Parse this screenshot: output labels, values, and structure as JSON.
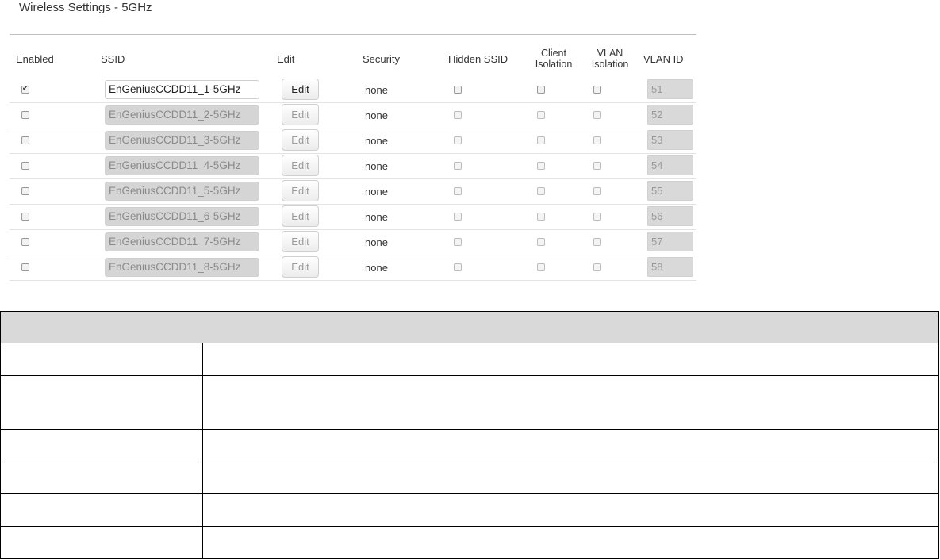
{
  "panel": {
    "title": "Wireless Settings - 5GHz",
    "headers": {
      "enabled": "Enabled",
      "ssid": "SSID",
      "edit": "Edit",
      "security": "Security",
      "hidden_ssid": "Hidden SSID",
      "client_isolation_1": "Client",
      "client_isolation_2": "Isolation",
      "vlan_isolation_1": "VLAN",
      "vlan_isolation_2": "Isolation",
      "vlan_id": "VLAN ID"
    },
    "rows": [
      {
        "enabled": true,
        "ssid": "EnGeniusCCDD11_1-5GHz",
        "edit": "Edit",
        "security": "none",
        "vlan_id": "51"
      },
      {
        "enabled": false,
        "ssid": "EnGeniusCCDD11_2-5GHz",
        "edit": "Edit",
        "security": "none",
        "vlan_id": "52"
      },
      {
        "enabled": false,
        "ssid": "EnGeniusCCDD11_3-5GHz",
        "edit": "Edit",
        "security": "none",
        "vlan_id": "53"
      },
      {
        "enabled": false,
        "ssid": "EnGeniusCCDD11_4-5GHz",
        "edit": "Edit",
        "security": "none",
        "vlan_id": "54"
      },
      {
        "enabled": false,
        "ssid": "EnGeniusCCDD11_5-5GHz",
        "edit": "Edit",
        "security": "none",
        "vlan_id": "55"
      },
      {
        "enabled": false,
        "ssid": "EnGeniusCCDD11_6-5GHz",
        "edit": "Edit",
        "security": "none",
        "vlan_id": "56"
      },
      {
        "enabled": false,
        "ssid": "EnGeniusCCDD11_7-5GHz",
        "edit": "Edit",
        "security": "none",
        "vlan_id": "57"
      },
      {
        "enabled": false,
        "ssid": "EnGeniusCCDD11_8-5GHz",
        "edit": "Edit",
        "security": "none",
        "vlan_id": "58"
      }
    ]
  },
  "description_table": {
    "rows": [
      [
        "",
        ""
      ],
      [
        "",
        ""
      ],
      [
        "",
        ""
      ],
      [
        "",
        ""
      ],
      [
        "",
        ""
      ],
      [
        "",
        ""
      ]
    ]
  },
  "colors": {
    "disabled_field": "#d9d9d9",
    "table_header": "#d9d9d9",
    "border": "#000000"
  }
}
